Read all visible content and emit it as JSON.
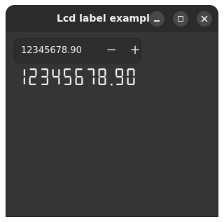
{
  "window": {
    "title": "Lcd label example",
    "controls": {
      "minimize": "minimize-icon",
      "maximize": "maximize-icon",
      "close": "close-icon"
    }
  },
  "spin_button": {
    "value": "12345678.90",
    "decrement_icon": "minus-icon",
    "decrement_label": "−",
    "increment_icon": "plus-icon",
    "increment_label": "+"
  },
  "lcd": {
    "text": "12345678.90",
    "color": "#f2f2f2"
  },
  "colors": {
    "window_bg": "#353535",
    "titlebar_bg": "#2b2b2b",
    "entry_bg": "#2e2e2e",
    "text": "#f0f0f0"
  }
}
